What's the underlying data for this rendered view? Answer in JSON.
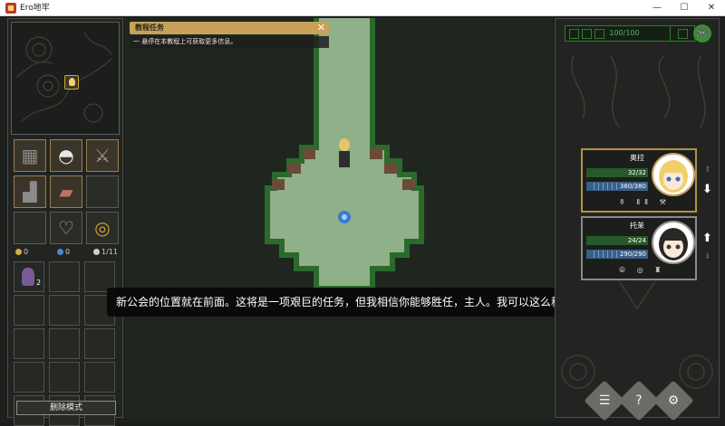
{
  "window": {
    "title": "Ero地牢",
    "minimize": "—",
    "maximize": "☐",
    "close": "✕"
  },
  "left_panel": {
    "equipment_slots": [
      {
        "name": "armor-top",
        "icon": "▦",
        "filled": true
      },
      {
        "name": "underwear",
        "icon": "◓",
        "filled": true
      },
      {
        "name": "sword",
        "icon": "⚔",
        "filled": true
      },
      {
        "name": "boots",
        "icon": "▟",
        "filled": true
      },
      {
        "name": "gauntlet",
        "icon": "▰",
        "filled": true
      },
      {
        "name": "empty-1",
        "icon": "",
        "filled": false
      },
      {
        "name": "empty-2",
        "icon": "",
        "filled": false
      },
      {
        "name": "heart",
        "icon": "♡",
        "filled": false
      },
      {
        "name": "spiral",
        "icon": "◎",
        "filled": false
      }
    ],
    "stats": {
      "gold": "0",
      "gems": "0",
      "bag": "1/11"
    },
    "inventory": {
      "first_item_count": "2",
      "slot_count": 15
    },
    "delete_button": "删除模式"
  },
  "quest": {
    "title": "教程任务",
    "close": "✕",
    "hint": "一 悬停在本教程上可获取更多信息。"
  },
  "dialog": {
    "text": "新公会的位置就在前面。这将是一项艰巨的任务，但我相信你能够胜任，主人。我可以这么称呼你，对吧？"
  },
  "right_panel": {
    "hp_display": "100/100",
    "party": [
      {
        "name": "奥拉",
        "hp": "32/32",
        "mp": "380/380",
        "icons": "⚱ ⅡⅡ ⚒",
        "hp_ratio": 1.0,
        "mp_ratio": 1.0
      },
      {
        "name": "托茉",
        "hp": "24/24",
        "mp": "290/290",
        "icons": "☮ ◎ ♜",
        "hp_ratio": 1.0,
        "mp_ratio": 1.0
      }
    ],
    "buttons": {
      "list": "☰",
      "help": "?",
      "settings": "⚙"
    },
    "gamepad_icon": "🎮"
  },
  "colors": {
    "accent_gold": "#c9a25a",
    "grass": "#8fb088",
    "hp_green": "#2f7a2f",
    "mp_blue": "#3a5f85"
  }
}
